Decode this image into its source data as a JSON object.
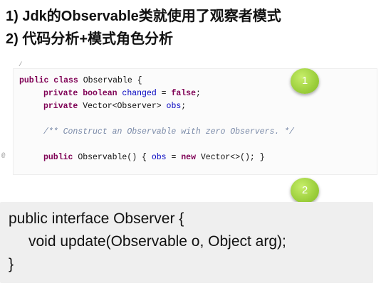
{
  "headings": {
    "line1": "1)  Jdk的Observable类就使用了观察者模式",
    "line2": "2)  代码分析+模式角色分析"
  },
  "snippet1": {
    "top_mark": "/",
    "gutter_mark": "@",
    "line1": {
      "kw": "public class",
      "rest": " Observable {"
    },
    "line2": {
      "kw": "private boolean",
      "field": " changed",
      "mid": " = ",
      "kw2": "false",
      "end": ";"
    },
    "line3": {
      "kw": "private",
      "mid": " Vector<Observer> ",
      "field": "obs",
      "end": ";"
    },
    "line4": {
      "comment": "/** Construct an Observable with zero Observers. */"
    },
    "line5": {
      "kw": "public",
      "mid": " Observable() { ",
      "field": "obs",
      "mid2": " = ",
      "kw2": "new",
      "end": " Vector<>(); }"
    }
  },
  "badges": {
    "b1": "1",
    "b2": "2"
  },
  "snippet2": {
    "line1": "public interface Observer {",
    "line2": "void update(Observable o, Object arg);",
    "line3": "}"
  },
  "colors": {
    "keyword": "#7f0055",
    "field": "#0000c0",
    "comment": "#7a8aa8",
    "badge": "#9ccf3c"
  }
}
